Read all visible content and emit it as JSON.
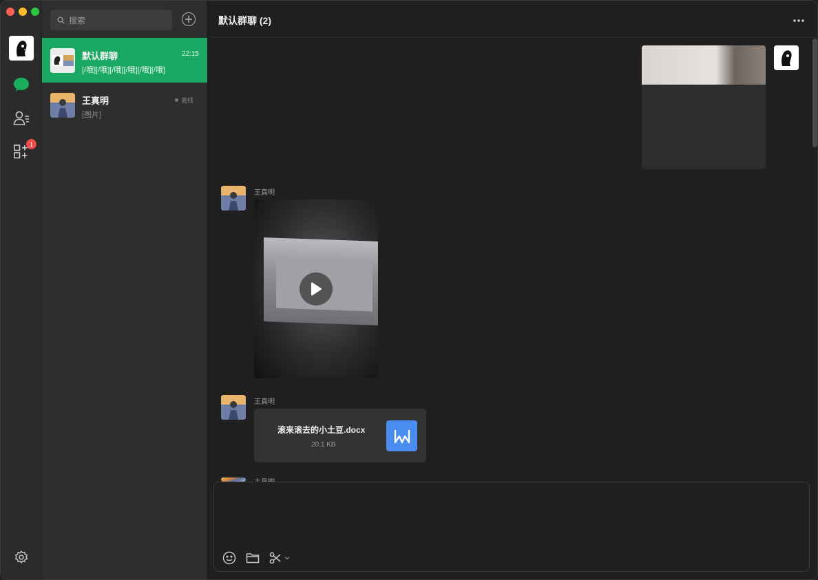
{
  "search": {
    "placeholder": "搜索"
  },
  "rail": {
    "badge_count": "1"
  },
  "conversations": [
    {
      "name": "默认群聊",
      "time": "22:15",
      "preview": "[/哦][/哦][/哦][/哦][/哦][/哦]",
      "active": true
    },
    {
      "name": "王真明",
      "status": "离线",
      "preview": "[图片]",
      "active": false
    }
  ],
  "chat": {
    "title": "默认群聊 (2)",
    "messages": [
      {
        "type": "image",
        "from": "self"
      },
      {
        "type": "video",
        "sender": "王真明"
      },
      {
        "type": "file",
        "sender": "王真明",
        "file_name": "滚来滚去的小土豆.docx",
        "file_size": "20.1 KB"
      },
      {
        "type": "partial",
        "sender": "王真明"
      }
    ]
  },
  "colors": {
    "accent_green": "#1aa863",
    "file_icon_blue": "#4a8cf0",
    "badge_red": "#f04b4b"
  }
}
